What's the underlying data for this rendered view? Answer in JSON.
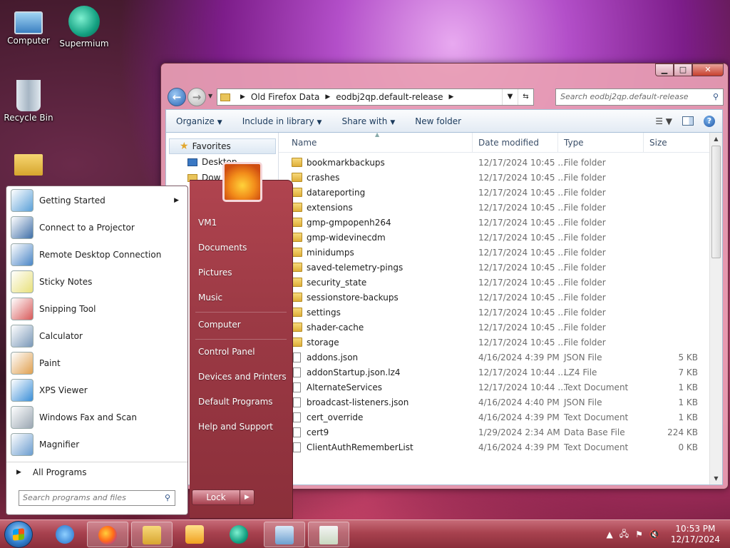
{
  "desktop": {
    "icons": [
      {
        "label": "Computer"
      },
      {
        "label": "Supermium"
      },
      {
        "label": "Recycle Bin"
      }
    ]
  },
  "explorer": {
    "breadcrumb": [
      "Old Firefox Data",
      "eodbj2qp.default-release"
    ],
    "search_placeholder": "Search eodbj2qp.default-release",
    "toolbar": {
      "organize": "Organize",
      "include": "Include in library",
      "share": "Share with",
      "new_folder": "New folder"
    },
    "nav": {
      "favorites": "Favorites",
      "desktop": "Desktop",
      "downloads": "Dow"
    },
    "columns": {
      "name": "Name",
      "date": "Date modified",
      "type": "Type",
      "size": "Size"
    },
    "files": [
      {
        "name": "bookmarkbackups",
        "date": "12/17/2024 10:45 ...",
        "type": "File folder",
        "size": "",
        "kind": "folder"
      },
      {
        "name": "crashes",
        "date": "12/17/2024 10:45 ...",
        "type": "File folder",
        "size": "",
        "kind": "folder"
      },
      {
        "name": "datareporting",
        "date": "12/17/2024 10:45 ...",
        "type": "File folder",
        "size": "",
        "kind": "folder"
      },
      {
        "name": "extensions",
        "date": "12/17/2024 10:45 ...",
        "type": "File folder",
        "size": "",
        "kind": "folder"
      },
      {
        "name": "gmp-gmpopenh264",
        "date": "12/17/2024 10:45 ...",
        "type": "File folder",
        "size": "",
        "kind": "folder"
      },
      {
        "name": "gmp-widevinecdm",
        "date": "12/17/2024 10:45 ...",
        "type": "File folder",
        "size": "",
        "kind": "folder"
      },
      {
        "name": "minidumps",
        "date": "12/17/2024 10:45 ...",
        "type": "File folder",
        "size": "",
        "kind": "folder"
      },
      {
        "name": "saved-telemetry-pings",
        "date": "12/17/2024 10:45 ...",
        "type": "File folder",
        "size": "",
        "kind": "folder"
      },
      {
        "name": "security_state",
        "date": "12/17/2024 10:45 ...",
        "type": "File folder",
        "size": "",
        "kind": "folder"
      },
      {
        "name": "sessionstore-backups",
        "date": "12/17/2024 10:45 ...",
        "type": "File folder",
        "size": "",
        "kind": "folder"
      },
      {
        "name": "settings",
        "date": "12/17/2024 10:45 ...",
        "type": "File folder",
        "size": "",
        "kind": "folder"
      },
      {
        "name": "shader-cache",
        "date": "12/17/2024 10:45 ...",
        "type": "File folder",
        "size": "",
        "kind": "folder"
      },
      {
        "name": "storage",
        "date": "12/17/2024 10:45 ...",
        "type": "File folder",
        "size": "",
        "kind": "folder"
      },
      {
        "name": "addons.json",
        "date": "4/16/2024 4:39 PM",
        "type": "JSON File",
        "size": "5 KB",
        "kind": "file"
      },
      {
        "name": "addonStartup.json.lz4",
        "date": "12/17/2024 10:44 ...",
        "type": "LZ4 File",
        "size": "7 KB",
        "kind": "file"
      },
      {
        "name": "AlternateServices",
        "date": "12/17/2024 10:44 ...",
        "type": "Text Document",
        "size": "1 KB",
        "kind": "file"
      },
      {
        "name": "broadcast-listeners.json",
        "date": "4/16/2024 4:40 PM",
        "type": "JSON File",
        "size": "1 KB",
        "kind": "file"
      },
      {
        "name": "cert_override",
        "date": "4/16/2024 4:39 PM",
        "type": "Text Document",
        "size": "1 KB",
        "kind": "file"
      },
      {
        "name": "cert9",
        "date": "1/29/2024 2:34 AM",
        "type": "Data Base File",
        "size": "224 KB",
        "kind": "file"
      },
      {
        "name": "ClientAuthRememberList",
        "date": "4/16/2024 4:39 PM",
        "type": "Text Document",
        "size": "0 KB",
        "kind": "file"
      }
    ]
  },
  "startmenu": {
    "programs": [
      {
        "label": "Getting Started",
        "has_arrow": true,
        "color": "#5aa0d8"
      },
      {
        "label": "Connect to a Projector",
        "has_arrow": false,
        "color": "#3f6fa8"
      },
      {
        "label": "Remote Desktop Connection",
        "has_arrow": false,
        "color": "#4a86c6"
      },
      {
        "label": "Sticky Notes",
        "has_arrow": false,
        "color": "#e8e07a"
      },
      {
        "label": "Snipping Tool",
        "has_arrow": false,
        "color": "#d85a5a"
      },
      {
        "label": "Calculator",
        "has_arrow": false,
        "color": "#7a98b8"
      },
      {
        "label": "Paint",
        "has_arrow": false,
        "color": "#e0a050"
      },
      {
        "label": "XPS Viewer",
        "has_arrow": false,
        "color": "#3b8fd8"
      },
      {
        "label": "Windows Fax and Scan",
        "has_arrow": false,
        "color": "#9aa6b2"
      },
      {
        "label": "Magnifier",
        "has_arrow": false,
        "color": "#6a9ccf"
      }
    ],
    "all_programs": "All Programs",
    "search_placeholder": "Search programs and files",
    "right_links": [
      "VM1",
      "Documents",
      "Pictures",
      "Music",
      "Computer",
      "Control Panel",
      "Devices and Printers",
      "Default Programs",
      "Help and Support"
    ],
    "lock_label": "Lock"
  },
  "taskbar": {
    "time": "10:53 PM",
    "date": "12/17/2024"
  }
}
